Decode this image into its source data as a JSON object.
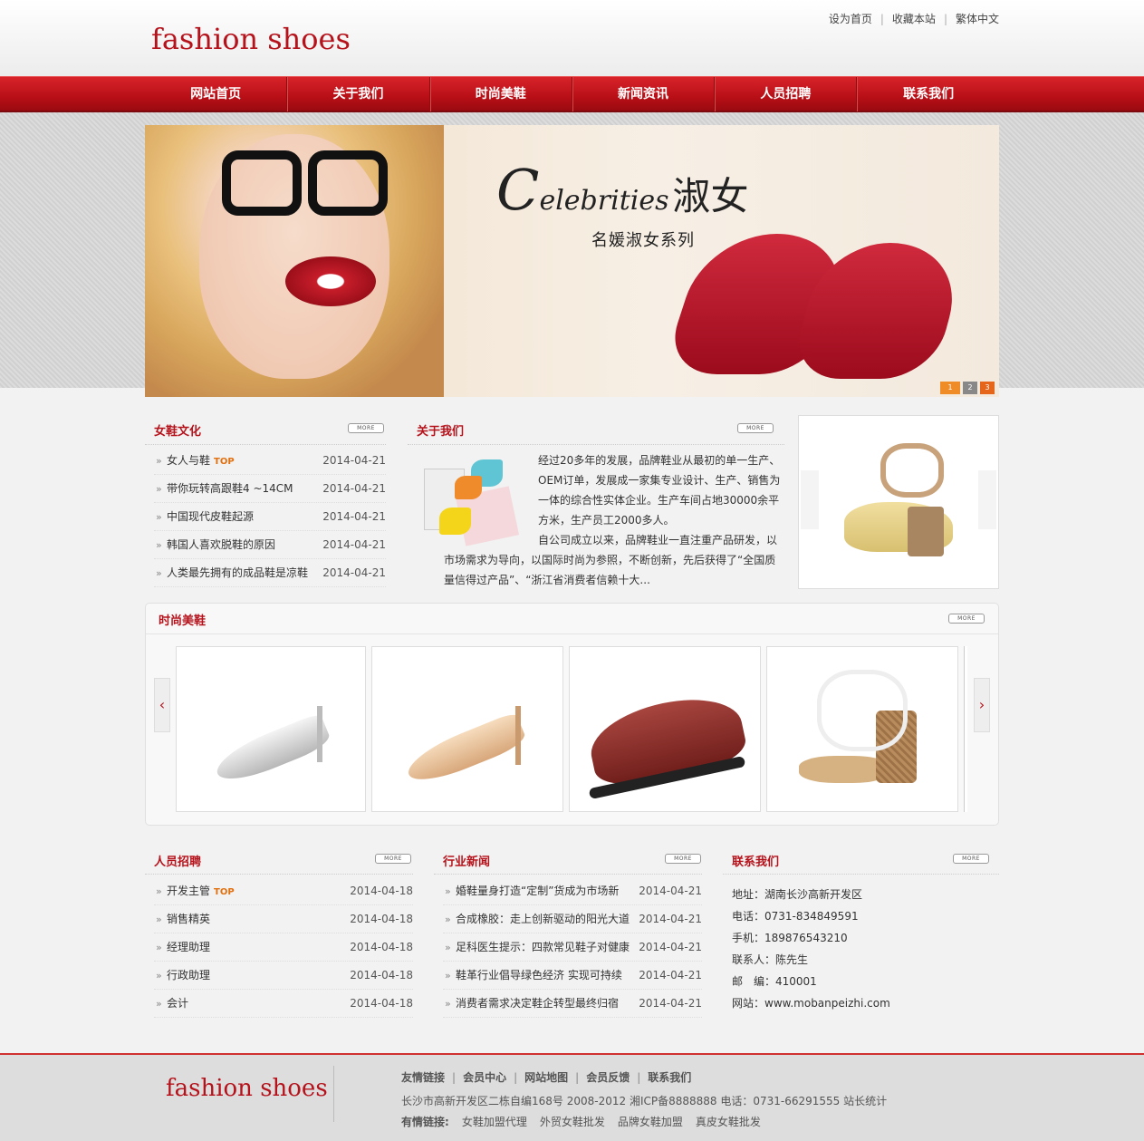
{
  "header": {
    "logo": "fashion shoes",
    "top_links": [
      "设为首页",
      "收藏本站",
      "繁体中文"
    ]
  },
  "nav": [
    "网站首页",
    "关于我们",
    "时尚美鞋",
    "新闻资讯",
    "人员招聘",
    "联系我们"
  ],
  "banner": {
    "title_initial": "C",
    "title_rest": "elebrities",
    "title_cn": "淑女",
    "subtitle": "名媛淑女系列",
    "pages": [
      "1",
      "2",
      "3"
    ]
  },
  "culture": {
    "title": "女鞋文化",
    "more": "MORE",
    "items": [
      {
        "text": "女人与鞋",
        "tag": "TOP",
        "date": "2014-04-21"
      },
      {
        "text": "带你玩转高跟鞋4 ~14CM",
        "tag": "",
        "date": "2014-04-21"
      },
      {
        "text": "中国现代皮鞋起源",
        "tag": "",
        "date": "2014-04-21"
      },
      {
        "text": "韩国人喜欢脱鞋的原因",
        "tag": "",
        "date": "2014-04-21"
      },
      {
        "text": "人类最先拥有的成品鞋是凉鞋",
        "tag": "",
        "date": "2014-04-21"
      }
    ]
  },
  "about": {
    "title": "关于我们",
    "more": "MORE",
    "text1": "经过20多年的发展，品牌鞋业从最初的单一生产、OEM订单，发展成一家集专业设计、生产、销售为一体的综合性实体企业。生产车间占地30000余平方米，生产员工2000多人。",
    "text2": "自公司成立以来，品牌鞋业一直注重产品研发，以市场需求为导向，以国际时尚为参照，不断创新，先后获得了“全国质量信得过产品”、“浙江省消费者信赖十大..."
  },
  "shoes": {
    "title": "时尚美鞋",
    "more": "MORE",
    "prev": "‹",
    "next": "›"
  },
  "jobs": {
    "title": "人员招聘",
    "more": "MORE",
    "items": [
      {
        "text": "开发主管",
        "tag": "TOP",
        "date": "2014-04-18"
      },
      {
        "text": "销售精英",
        "tag": "",
        "date": "2014-04-18"
      },
      {
        "text": "经理助理",
        "tag": "",
        "date": "2014-04-18"
      },
      {
        "text": "行政助理",
        "tag": "",
        "date": "2014-04-18"
      },
      {
        "text": "会计",
        "tag": "",
        "date": "2014-04-18"
      }
    ]
  },
  "news": {
    "title": "行业新闻",
    "more": "MORE",
    "items": [
      {
        "text": "婚鞋量身打造“定制”货成为市场新",
        "date": "2014-04-21"
      },
      {
        "text": "合成橡胶：走上创新驱动的阳光大道",
        "date": "2014-04-21"
      },
      {
        "text": "足科医生提示：四款常见鞋子对健康",
        "date": "2014-04-21"
      },
      {
        "text": "鞋革行业倡导绿色经济 实现可持续",
        "date": "2014-04-21"
      },
      {
        "text": "消费者需求决定鞋企转型最终归宿",
        "date": "2014-04-21"
      }
    ]
  },
  "contact": {
    "title": "联系我们",
    "more": "MORE",
    "lines": [
      "地址：湖南长沙高新开发区",
      "电话：0731-834849591",
      "手机：189876543210",
      "联系人：陈先生",
      "邮　编：410001",
      "网站：www.mobanpeizhi.com"
    ]
  },
  "footer": {
    "logo": "fashion shoes",
    "links": [
      "友情链接",
      "会员中心",
      "网站地图",
      "会员反馈",
      "联系我们"
    ],
    "copyright": "长沙市高新开发区二栋自编168号 2008-2012 湘ICP备8888888 电话：0731-66291555 站长统计",
    "friends_label": "有情链接:",
    "friends": [
      "女鞋加盟代理",
      "外贸女鞋批发",
      "品牌女鞋加盟",
      "真皮女鞋批发"
    ]
  }
}
